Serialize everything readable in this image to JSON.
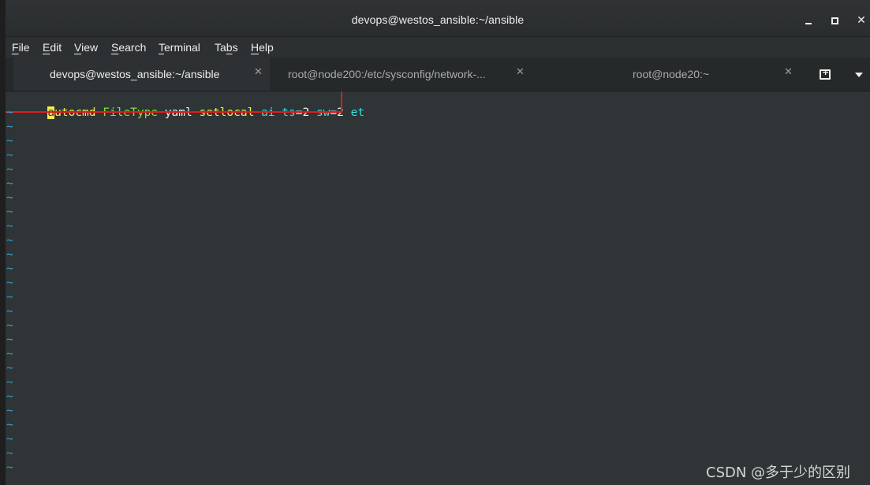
{
  "window": {
    "title": "devops@westos_ansible:~/ansible",
    "controls": {
      "minimize": "minimize",
      "maximize": "maximize",
      "close": "✕"
    }
  },
  "menubar": {
    "items": [
      {
        "label": "File",
        "mnemonic_index": 0
      },
      {
        "label": "Edit",
        "mnemonic_index": 0
      },
      {
        "label": "View",
        "mnemonic_index": 0
      },
      {
        "label": "Search",
        "mnemonic_index": 0
      },
      {
        "label": "Terminal",
        "mnemonic_index": 0
      },
      {
        "label": "Tabs",
        "mnemonic_index": 2
      },
      {
        "label": "Help",
        "mnemonic_index": 0
      }
    ]
  },
  "tabs": [
    {
      "label": "devops@westos_ansible:~/ansible",
      "active": true,
      "close": "✕"
    },
    {
      "label": "root@node200:/etc/sysconfig/network-...",
      "active": false,
      "close": "✕"
    },
    {
      "label": "root@node20:~",
      "active": false,
      "close": "✕"
    }
  ],
  "tab_actions": {
    "new_tab_icon": "new-tab-icon",
    "tab_menu_icon": "chevron-down-icon"
  },
  "editor": {
    "line1": {
      "cursor_char": "a",
      "segments": [
        {
          "text": "utocmd",
          "role": "command"
        },
        {
          "text": " ",
          "role": "plain"
        },
        {
          "text": "FileType",
          "role": "filetype"
        },
        {
          "text": " yaml ",
          "role": "plain"
        },
        {
          "text": "setlocal",
          "role": "command"
        },
        {
          "text": " ",
          "role": "plain"
        },
        {
          "text": "ai",
          "role": "option"
        },
        {
          "text": " ",
          "role": "plain"
        },
        {
          "text": "ts",
          "role": "option"
        },
        {
          "text": "=2 ",
          "role": "plain"
        },
        {
          "text": "sw",
          "role": "option"
        },
        {
          "text": "=2 ",
          "role": "plain"
        },
        {
          "text": "et",
          "role": "option"
        }
      ]
    },
    "empty_line_marker": "~",
    "empty_line_count": 26
  },
  "colors": {
    "command": "#fce94f",
    "filetype": "#8ae234",
    "option": "#34e2e2",
    "plain": "#eeeeec",
    "tilde": "#34a0d4",
    "highlight_box": "#e01c1c"
  },
  "watermark": "CSDN @多于少的区别"
}
